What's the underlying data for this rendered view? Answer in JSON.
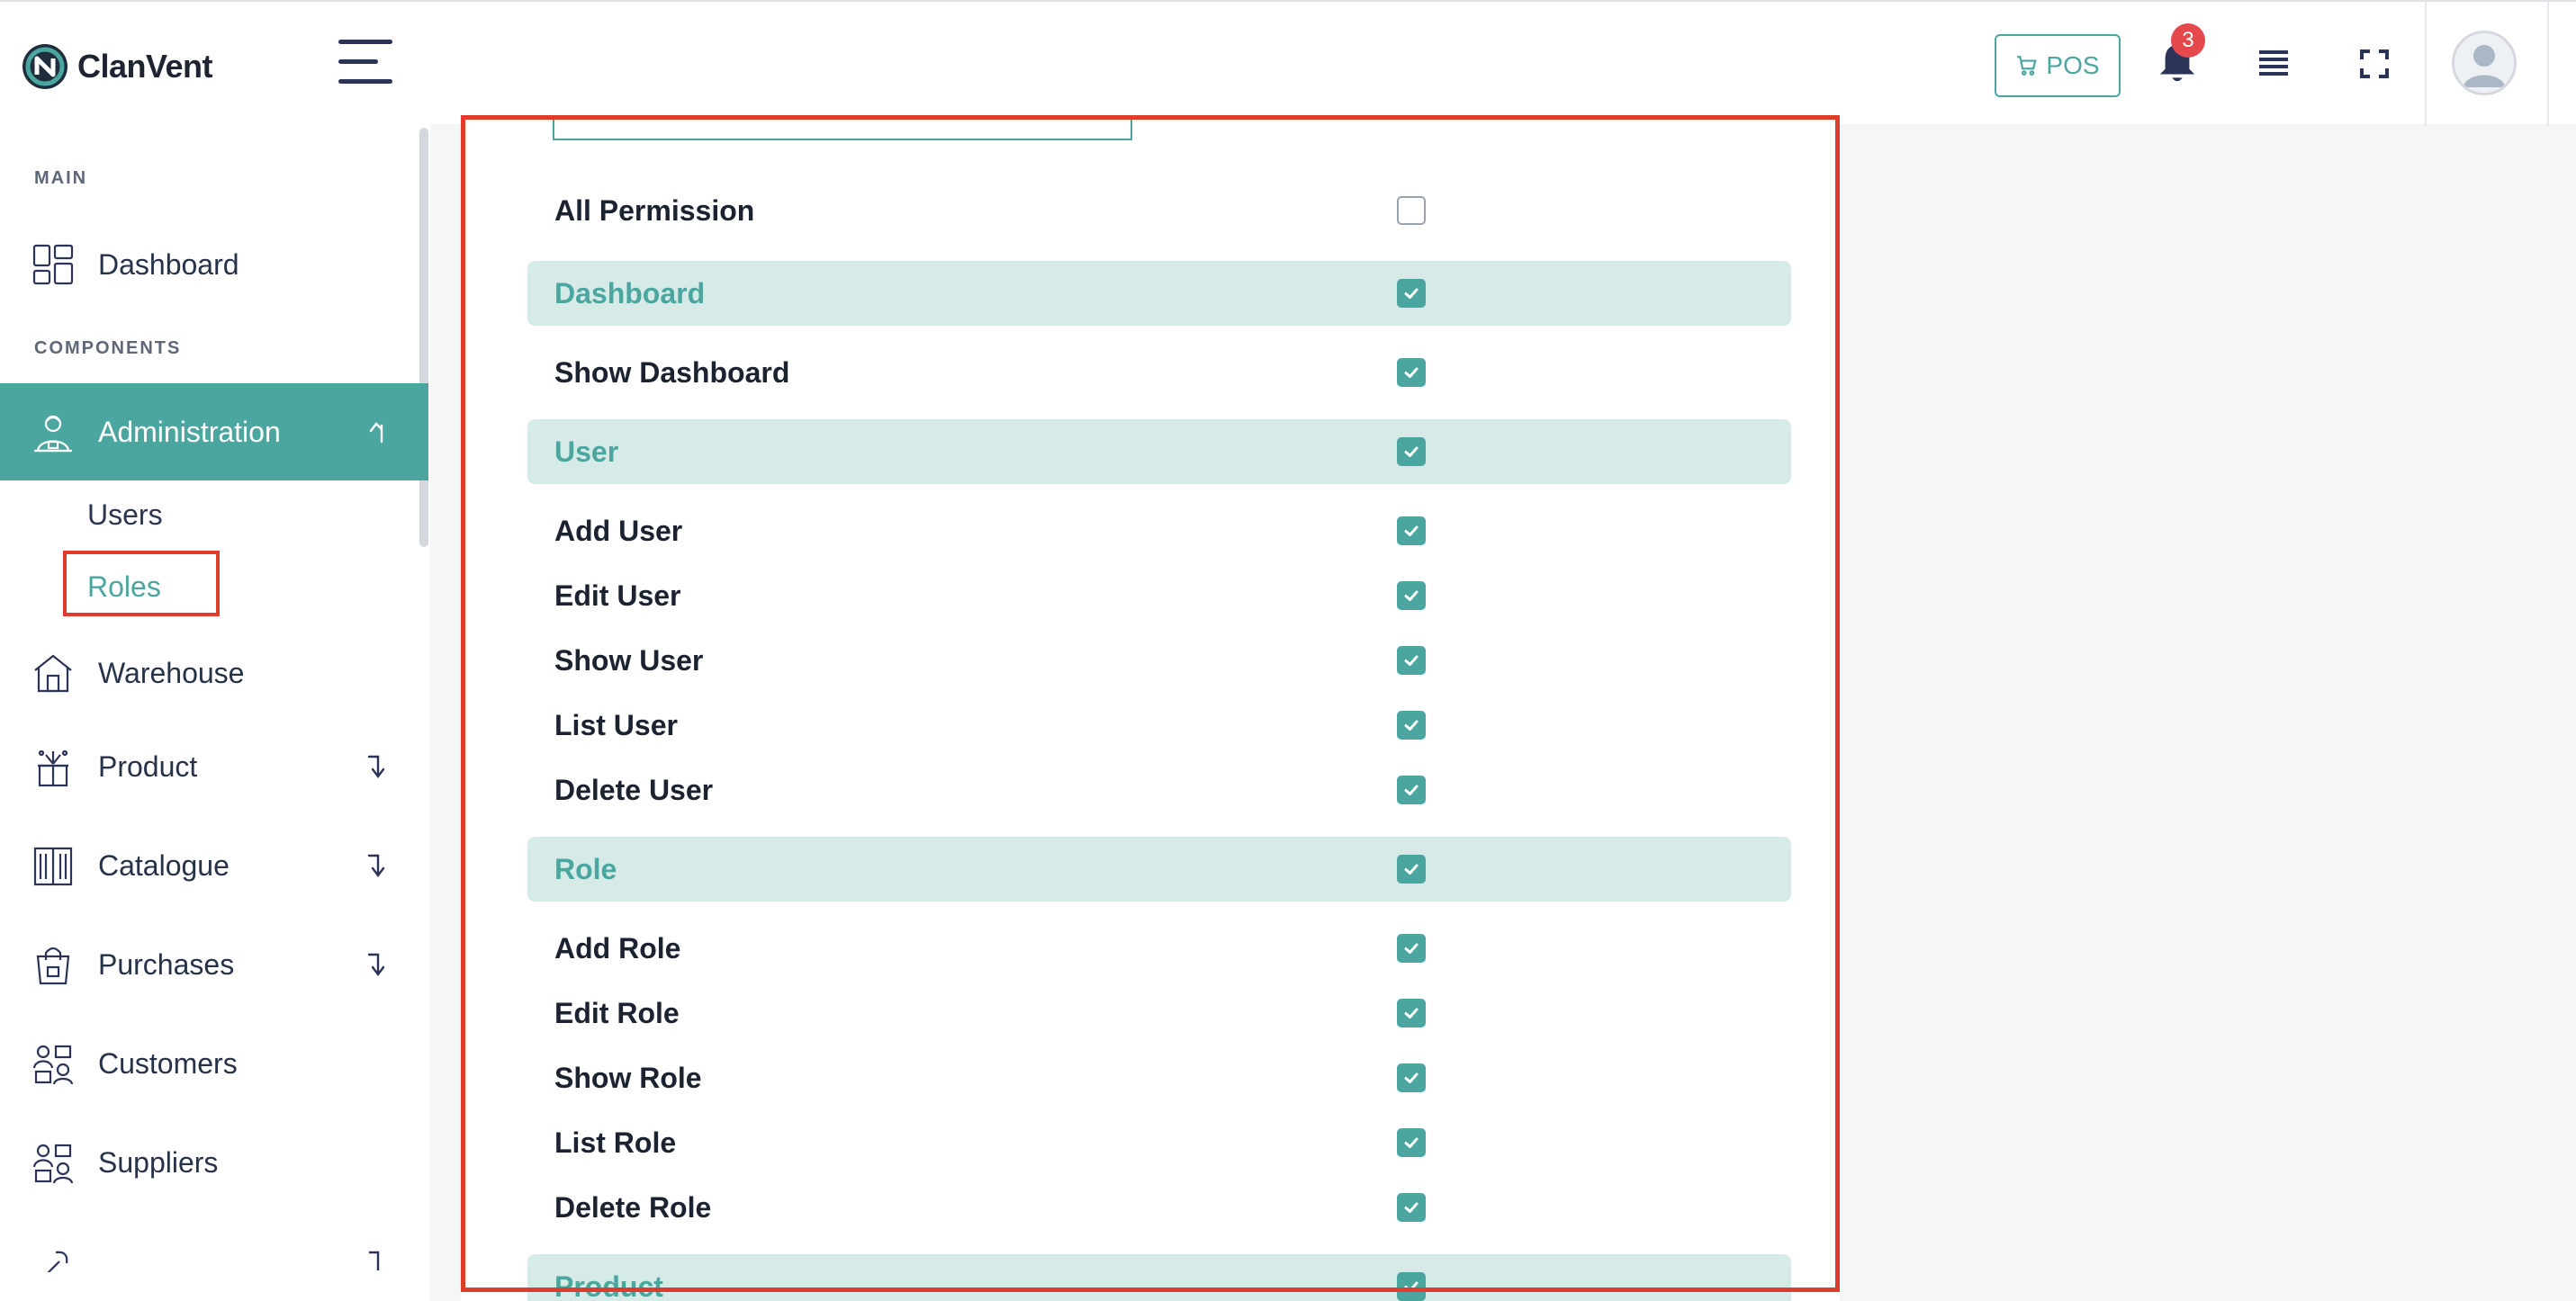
{
  "brand": {
    "name": "ClanVent"
  },
  "header": {
    "pos_label": "POS",
    "notification_count": "3"
  },
  "colors": {
    "accent": "#4aa69f",
    "group_bg": "#d6ebe8",
    "highlight": "#e03c2c",
    "badge": "#e5484d"
  },
  "sidebar": {
    "section_main": "MAIN",
    "section_components": "COMPONENTS",
    "items": [
      {
        "label": "Dashboard",
        "icon": "dashboard-icon"
      },
      {
        "label": "Administration",
        "icon": "admin-icon",
        "active": true,
        "expanded": true
      },
      {
        "label": "Warehouse",
        "icon": "warehouse-icon"
      },
      {
        "label": "Product",
        "icon": "product-icon"
      },
      {
        "label": "Catalogue",
        "icon": "catalogue-icon"
      },
      {
        "label": "Purchases",
        "icon": "purchases-icon"
      },
      {
        "label": "Customers",
        "icon": "customers-icon"
      },
      {
        "label": "Suppliers",
        "icon": "suppliers-icon"
      }
    ],
    "sub_items": [
      {
        "label": "Users"
      },
      {
        "label": "Roles",
        "current": true
      }
    ]
  },
  "permissions": {
    "all_label": "All Permission",
    "all_checked": false,
    "rows": [
      {
        "label": "Dashboard",
        "group": true,
        "checked": true
      },
      {
        "label": "Show Dashboard",
        "checked": true
      },
      {
        "label": "User",
        "group": true,
        "checked": true
      },
      {
        "label": "Add User",
        "checked": true
      },
      {
        "label": "Edit User",
        "checked": true
      },
      {
        "label": "Show User",
        "checked": true
      },
      {
        "label": "List User",
        "checked": true
      },
      {
        "label": "Delete User",
        "checked": true
      },
      {
        "label": "Role",
        "group": true,
        "checked": true
      },
      {
        "label": "Add Role",
        "checked": true
      },
      {
        "label": "Edit Role",
        "checked": true
      },
      {
        "label": "Show Role",
        "checked": true
      },
      {
        "label": "List Role",
        "checked": true
      },
      {
        "label": "Delete Role",
        "checked": true
      },
      {
        "label": "Product",
        "group": true,
        "checked": true
      }
    ]
  }
}
